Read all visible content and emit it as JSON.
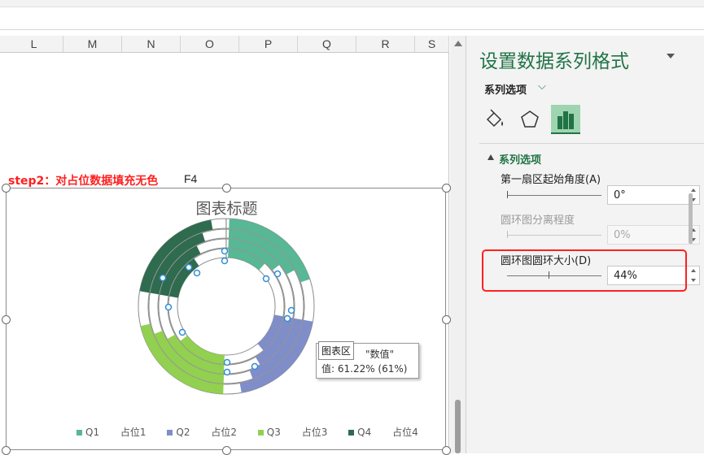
{
  "columns": [
    "L",
    "M",
    "N",
    "O",
    "P",
    "Q",
    "R",
    "S"
  ],
  "sheet": {
    "step_text": "step2：对占位数据填充无色",
    "cell_f4": "F4"
  },
  "chart": {
    "title": "图表标题",
    "legend": [
      {
        "label": "Q1",
        "color": "#58b794"
      },
      {
        "label": "占位1",
        "color": null
      },
      {
        "label": "Q2",
        "color": "#7f8dc9"
      },
      {
        "label": "占位2",
        "color": null
      },
      {
        "label": "Q3",
        "color": "#92d050"
      },
      {
        "label": "占位3",
        "color": null
      },
      {
        "label": "Q4",
        "color": "#2e6b4f"
      },
      {
        "label": "占位4",
        "color": null
      }
    ],
    "tooltip_tag": "图表区",
    "tooltip_line1": "\"数值\"",
    "tooltip_line2": "值: 61.22% (61%)"
  },
  "pane": {
    "title": "设置数据系列格式",
    "series_options_dropdown": "系列选项",
    "tabs": [
      "fill-line-icon",
      "effects-icon",
      "series-options-icon"
    ],
    "section_title": "系列选项",
    "first_slice_angle_label": "第一扇区起始角度(A)",
    "first_slice_angle_value": "0°",
    "explosion_label": "圆环图分离程度",
    "explosion_value": "0%",
    "hole_size_label": "圆环图圆环大小(D)",
    "hole_size_value": "44%",
    "hole_size_fraction": 0.44,
    "accent_color": "#217346",
    "highlight_color": "#ff2020"
  }
}
